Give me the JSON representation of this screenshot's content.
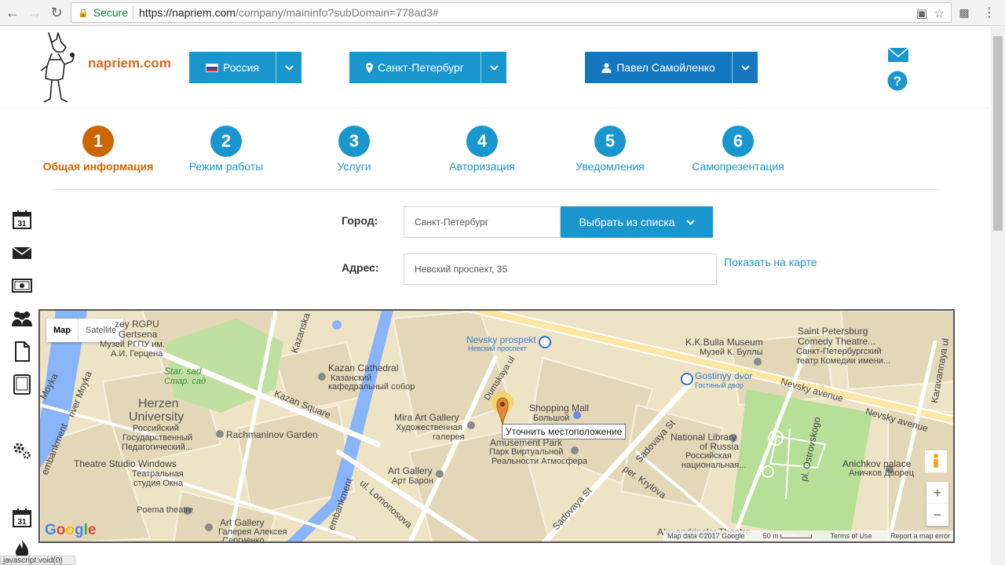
{
  "browser": {
    "secure_label": "Secure",
    "url_base": "https://napriem.com",
    "url_rest": "/company/maininfo?subDomain=778ad3#"
  },
  "header": {
    "brand": "napriem.com",
    "country": "Россия",
    "city": "Санкт-Петербург",
    "user": "Павел Самойленко"
  },
  "steps": [
    {
      "num": "1",
      "label": "Общая информация"
    },
    {
      "num": "2",
      "label": "Режим работы"
    },
    {
      "num": "3",
      "label": "Услуги"
    },
    {
      "num": "4",
      "label": "Авторизация"
    },
    {
      "num": "5",
      "label": "Уведомления"
    },
    {
      "num": "6",
      "label": "Самопрезентация"
    }
  ],
  "form": {
    "city_label": "Город:",
    "city_value": "Санкт-Петербург",
    "pick_button": "Выбрать из списка",
    "address_label": "Адрес:",
    "address_value": "Невский проспект, 35",
    "show_on_map": "Показать на карте"
  },
  "map": {
    "type_map": "Map",
    "type_satellite": "Satellite",
    "tooltip": "Уточнить местоположение",
    "labels": {
      "nevsky_prospekt": "Nevsky prospekt",
      "nevsky_prospekt_ru": "Невский проспект",
      "kazan_cathedral": "Kazan Cathedral",
      "kazan_cathedral_ru1": "Казанский",
      "kazan_cathedral_ru2": "кафедральный собор",
      "kazan_square": "Kazan Square",
      "herzen": "Herzen",
      "university": "University",
      "herzen_ru1": "Российский",
      "herzen_ru2": "Государственный",
      "herzen_ru3": "Педагогический...",
      "rgpu1": "zey RGPU",
      "rgpu2": "Gertsena",
      "rgpu3": "Музей РГПУ им.",
      "rgpu4": "А.И. Герцена",
      "star_sad": "Star. sad",
      "star_sad_ru": "Стар. сад",
      "rachmaninov": "Rachmaninov Garden",
      "mira_gallery": "Mira Art Gallery",
      "mira_ru1": "Художественная",
      "mira_ru2": "галерея",
      "shopping_mall": "Shopping Mall",
      "shopping_ru": "Большой",
      "amusement": "Amusement Park",
      "amusement_ru1": "Парк Виртуальной",
      "amusement_ru2": "Реальности Атмосфера",
      "art_gallery": "Art Gallery",
      "art_gallery_ru": "Арт Барон",
      "theatre_studio": "Theatre Studio Windows",
      "theatre_studio_ru1": "Театральная",
      "theatre_studio_ru2": "студия Окна",
      "poema": "Poema theatre",
      "art_gallery2": "Art Gallery",
      "art_gallery2_ru1": "Галерея Алексея",
      "art_gallery2_ru2": "Сергиенко",
      "bulla": "K.K.Bulla Museum",
      "bulla_ru": "Музей К. Буллы",
      "comedy1": "Saint Petersburg",
      "comedy2": "Comedy Theatre...",
      "comedy_ru1": "Санкт-Петербургский",
      "comedy_ru2": "театр Комедии имени...",
      "gostinyy": "Gostinyy dvor",
      "gostinyy_ru": "Гостиный двор",
      "national1": "National Library",
      "national2": "of Russia",
      "national_ru1": "Российская",
      "national_ru2": "национальная...",
      "anichkov": "Anichkov palace",
      "anichkov_ru": "Аничков Дворец",
      "alexandrinsky": "Alexandrinsky Theatre",
      "nevsky_avenue": "Nevsky avenue",
      "nevsky_avenue2": "Nevsky avenue",
      "dumskaya": "Dumskaya ul",
      "kazanskaya": "Kazanska",
      "sadovaya": "Sadovaya St",
      "sadovaya2": "Sadovaya St",
      "krylova": "per. Krylova",
      "lomonosova": "ul. Lomonosova",
      "ostrovsky": "pl. Ostrovskogo",
      "karavannaya": "Karavannaya ul",
      "moyka": "Moyka",
      "moyka2": "river Moyka",
      "embankment": "embankment",
      "embankment2": "embankment"
    },
    "footer": {
      "map_data": "Map data ©2017 Google",
      "scale": "50 m",
      "terms": "Terms of Use",
      "report": "Report a map error"
    },
    "google": [
      "G",
      "o",
      "o",
      "g",
      "l",
      "e"
    ]
  },
  "status_text": "javascript:void(0)"
}
